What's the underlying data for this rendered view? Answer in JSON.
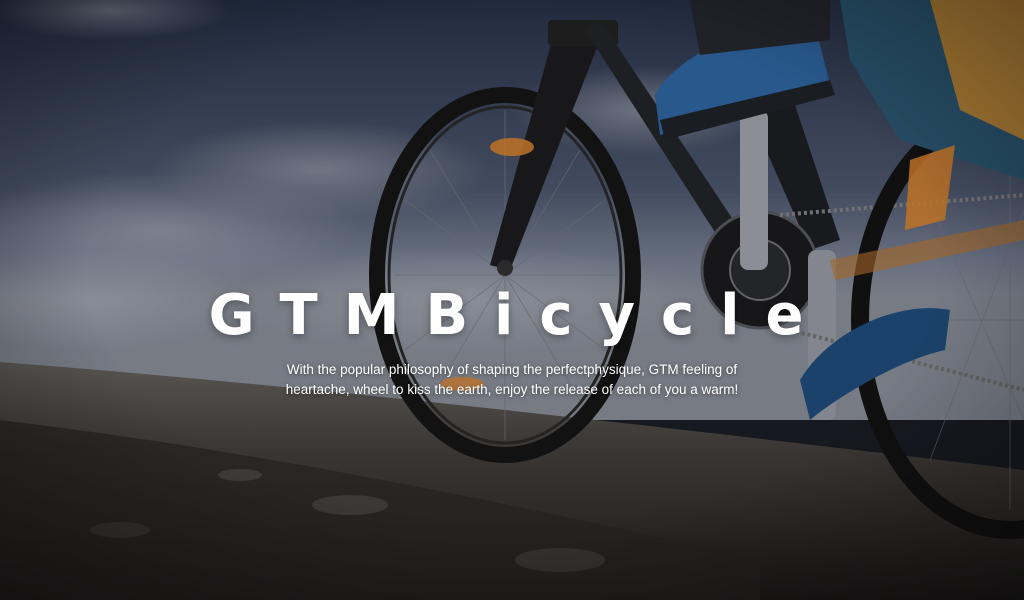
{
  "hero": {
    "title": "GTMBicycle",
    "description": "With the popular philosophy of shaping the perfectphysique,  GTM feeling of heartache, wheel to kiss the earth, enjoy the release of each of you a warm!"
  },
  "colors": {
    "sky_top": "#2e3a52",
    "sky_mid": "#6d7689",
    "ground": "#3b3632",
    "title_text": "#ffffff",
    "accent_orange": "#e8892b"
  },
  "icons": {
    "background": "bicycle-photo"
  }
}
